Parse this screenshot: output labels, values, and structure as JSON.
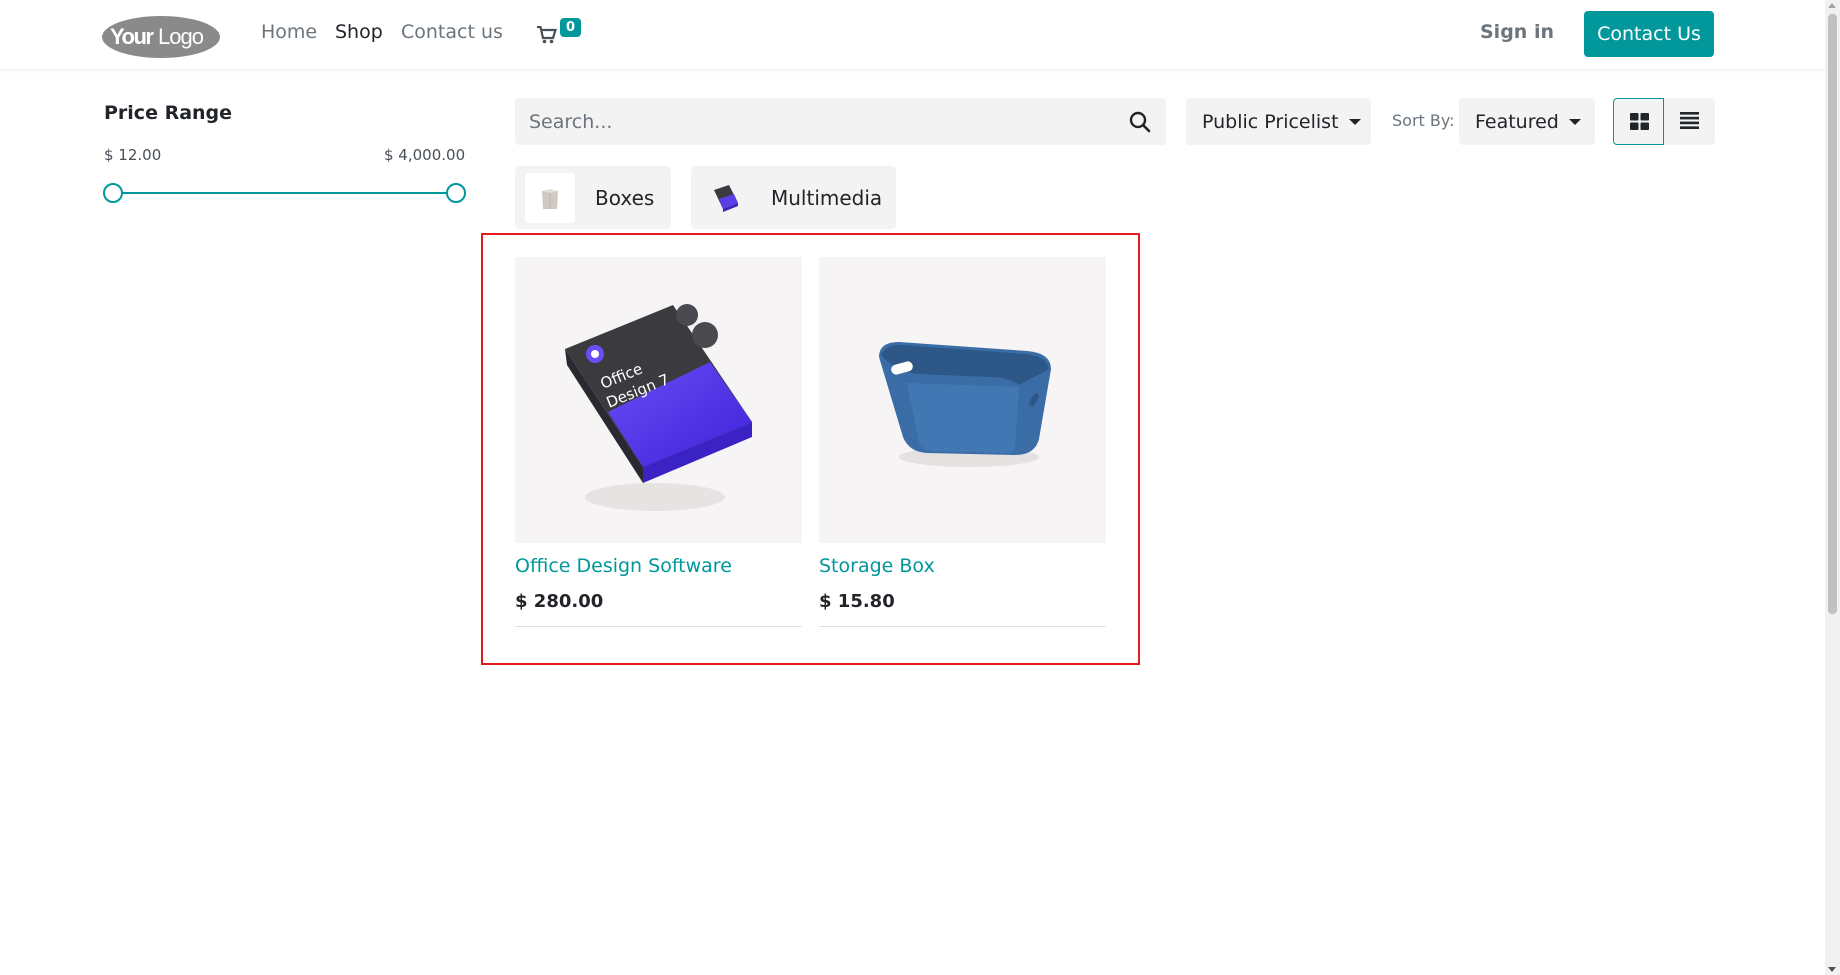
{
  "header": {
    "logo_text": "YourLogo",
    "nav": [
      {
        "label": "Home"
      },
      {
        "label": "Shop"
      },
      {
        "label": "Contact us"
      }
    ],
    "cart_count": "0",
    "signin_label": "Sign in",
    "contact_button": "Contact Us",
    "accent_color": "#01979b"
  },
  "sidebar": {
    "price_range_title": "Price Range",
    "min_label": "$ 12.00",
    "max_label": "$ 4,000.00"
  },
  "toolbar": {
    "search_placeholder": "Search...",
    "pricelist_label": "Public Pricelist",
    "sortby_label": "Sort By:",
    "sort_value": "Featured",
    "view_mode": "grid"
  },
  "categories": [
    {
      "label": "Boxes"
    },
    {
      "label": "Multimedia"
    }
  ],
  "products": [
    {
      "name": "Office Design Software",
      "price": "$ 280.00",
      "box_text_1": "Office",
      "box_text_2": "Design 7"
    },
    {
      "name": "Storage Box",
      "price": "$ 15.80"
    }
  ]
}
